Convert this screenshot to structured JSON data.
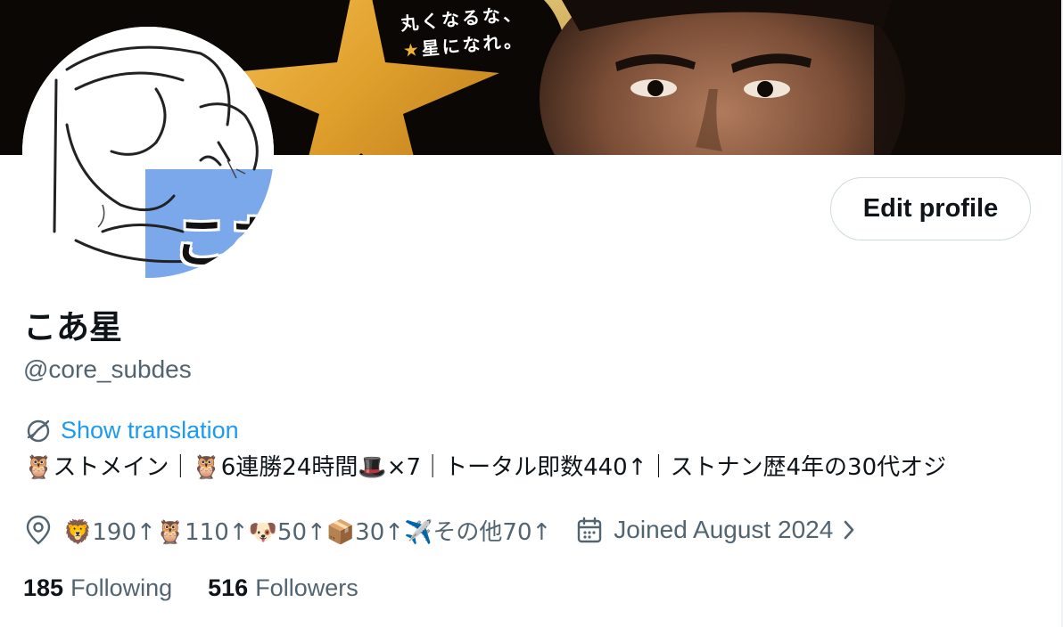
{
  "banner": {
    "tagline_line1": "丸くなるな、",
    "tagline_star": "★",
    "tagline_line2": "星になれ。"
  },
  "avatar": {
    "text": "こあ"
  },
  "actions": {
    "edit_profile": "Edit profile"
  },
  "profile": {
    "display_name": "こあ星",
    "handle": "@core_subdes",
    "show_translation": "Show translation",
    "bio": "🦉ストメイン｜🦉6連勝24時間🎩×7｜トータル即数440↑｜ストナン歴4年の30代オジ",
    "location": "🦁190↑🦉110↑🐶50↑📦30↑✈️その他70↑",
    "joined": "Joined August 2024"
  },
  "stats": {
    "following_count": "185",
    "following_label": "Following",
    "followers_count": "516",
    "followers_label": "Followers"
  },
  "icons": {
    "translate": "translate-icon",
    "location": "location-pin-icon",
    "calendar": "calendar-icon",
    "chevron": "chevron-right-icon"
  },
  "colors": {
    "link": "#1d9bf0",
    "secondary_text": "#536471",
    "primary_text": "#0f1419",
    "banner_star": "#f2b133"
  }
}
